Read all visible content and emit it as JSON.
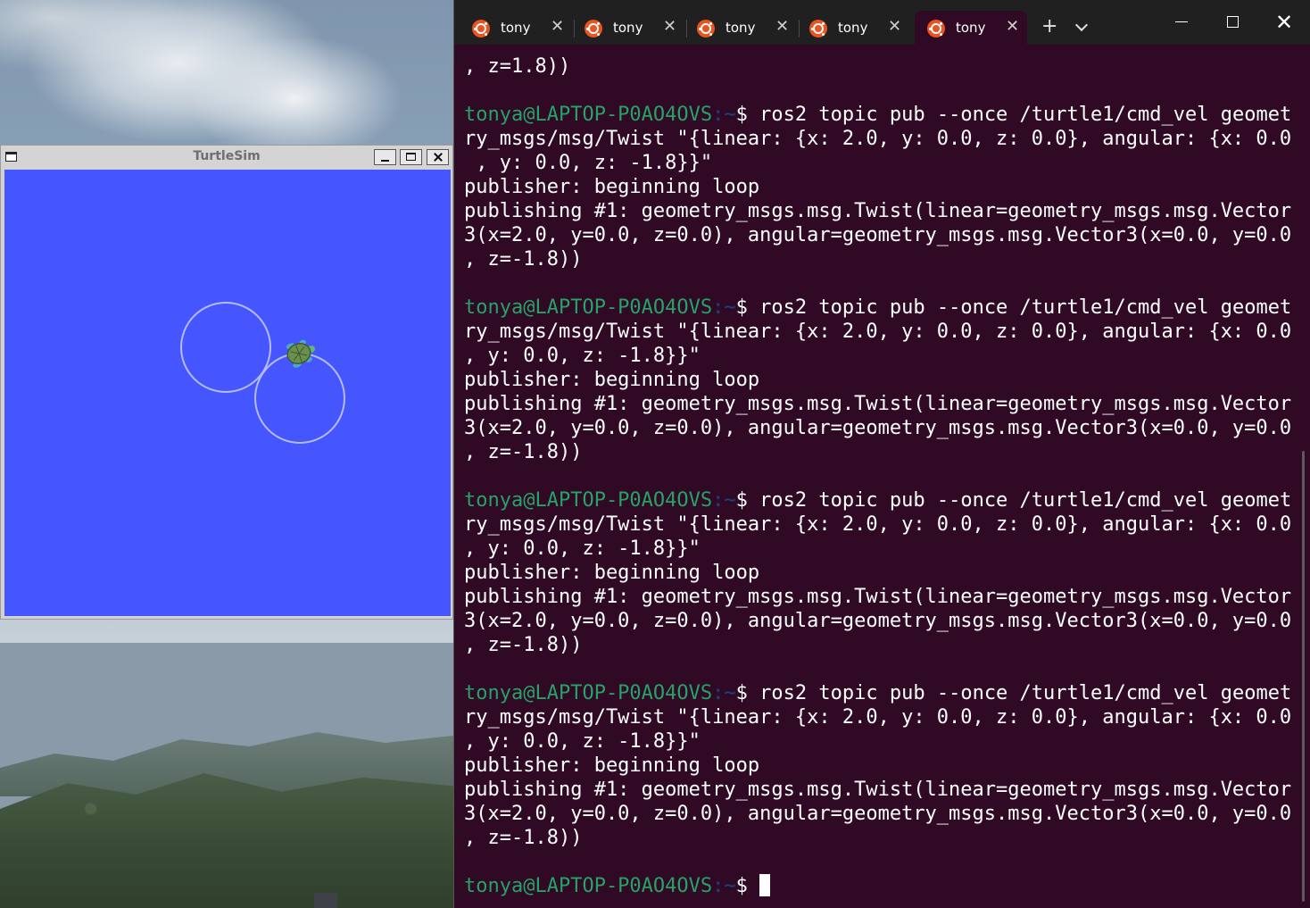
{
  "turtlesim": {
    "title": "TurtleSim",
    "canvas_color": "#4556ff",
    "trail_color": "#b4bcff"
  },
  "terminal": {
    "tabs": [
      {
        "label": "tony",
        "active": false
      },
      {
        "label": "tony",
        "active": false
      },
      {
        "label": "tony",
        "active": false
      },
      {
        "label": "tony",
        "active": false
      },
      {
        "label": "tony",
        "active": true
      }
    ],
    "new_tab_symbol": "+",
    "close_symbol": "✕",
    "prompt_user": "tonya@LAPTOP-P0AO4OVS",
    "prompt_path": ":~",
    "prompt_symbol": "$ ",
    "colors": {
      "background": "#300a24",
      "prompt_user": "#26a269",
      "prompt_path": "#12488b",
      "text": "#ffffff"
    },
    "lines": [
      {
        "text": ", z=1.8))"
      },
      {
        "text": ""
      },
      {
        "prompt": true,
        "text": "ros2 topic pub --once /turtle1/cmd_vel geomet"
      },
      {
        "text": "ry_msgs/msg/Twist \"{linear: {x: 2.0, y: 0.0, z: 0.0}, angular: {x: 0.0"
      },
      {
        "text": " , y: 0.0, z: -1.8}}\""
      },
      {
        "text": "publisher: beginning loop"
      },
      {
        "text": "publishing #1: geometry_msgs.msg.Twist(linear=geometry_msgs.msg.Vector"
      },
      {
        "text": "3(x=2.0, y=0.0, z=0.0), angular=geometry_msgs.msg.Vector3(x=0.0, y=0.0"
      },
      {
        "text": ", z=-1.8))"
      },
      {
        "text": ""
      },
      {
        "prompt": true,
        "text": "ros2 topic pub --once /turtle1/cmd_vel geomet"
      },
      {
        "text": "ry_msgs/msg/Twist \"{linear: {x: 2.0, y: 0.0, z: 0.0}, angular: {x: 0.0"
      },
      {
        "text": ", y: 0.0, z: -1.8}}\""
      },
      {
        "text": "publisher: beginning loop"
      },
      {
        "text": "publishing #1: geometry_msgs.msg.Twist(linear=geometry_msgs.msg.Vector"
      },
      {
        "text": "3(x=2.0, y=0.0, z=0.0), angular=geometry_msgs.msg.Vector3(x=0.0, y=0.0"
      },
      {
        "text": ", z=-1.8))"
      },
      {
        "text": ""
      },
      {
        "prompt": true,
        "text": "ros2 topic pub --once /turtle1/cmd_vel geomet"
      },
      {
        "text": "ry_msgs/msg/Twist \"{linear: {x: 2.0, y: 0.0, z: 0.0}, angular: {x: 0.0"
      },
      {
        "text": ", y: 0.0, z: -1.8}}\""
      },
      {
        "text": "publisher: beginning loop"
      },
      {
        "text": "publishing #1: geometry_msgs.msg.Twist(linear=geometry_msgs.msg.Vector"
      },
      {
        "text": "3(x=2.0, y=0.0, z=0.0), angular=geometry_msgs.msg.Vector3(x=0.0, y=0.0"
      },
      {
        "text": ", z=-1.8))"
      },
      {
        "text": ""
      },
      {
        "prompt": true,
        "text": "ros2 topic pub --once /turtle1/cmd_vel geomet"
      },
      {
        "text": "ry_msgs/msg/Twist \"{linear: {x: 2.0, y: 0.0, z: 0.0}, angular: {x: 0.0"
      },
      {
        "text": ", y: 0.0, z: -1.8}}\""
      },
      {
        "text": "publisher: beginning loop"
      },
      {
        "text": "publishing #1: geometry_msgs.msg.Twist(linear=geometry_msgs.msg.Vector"
      },
      {
        "text": "3(x=2.0, y=0.0, z=0.0), angular=geometry_msgs.msg.Vector3(x=0.0, y=0.0"
      },
      {
        "text": ", z=-1.8))"
      },
      {
        "text": ""
      },
      {
        "prompt": true,
        "text": "",
        "cursor": true
      }
    ]
  }
}
